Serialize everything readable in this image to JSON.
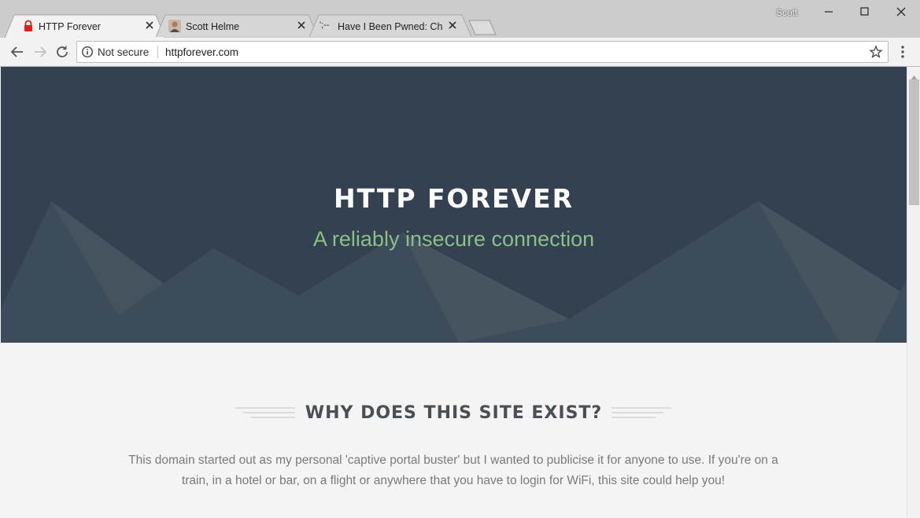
{
  "browser": {
    "tabs": [
      {
        "title": "HTTP Forever",
        "icon": "lock-icon",
        "active": true
      },
      {
        "title": "Scott Helme",
        "icon": "avatar-icon",
        "active": false
      },
      {
        "title": "Have I Been Pwned: Chec",
        "icon": "hibp-icon",
        "icon_text": "';--",
        "active": false
      }
    ],
    "profile_name": "Scott",
    "security_label": "Not secure",
    "url": "httpforever.com"
  },
  "page": {
    "hero": {
      "title": "HTTP FOREVER",
      "subtitle": "A reliably insecure connection"
    },
    "section": {
      "heading": "WHY DOES THIS SITE EXIST?",
      "body": "This domain started out as my personal 'captive portal buster' but I wanted to publicise it for anyone to use. If you're on a train, in a hotel or bar, on a flight or anywhere that you have to login for WiFi, this site could help you!"
    }
  },
  "colors": {
    "hero_bg": "#334150",
    "subtitle": "#8cbf8a",
    "heading": "#4a4f55",
    "body_text": "#7a7a7a",
    "insecure_lock": "#e0201b"
  }
}
